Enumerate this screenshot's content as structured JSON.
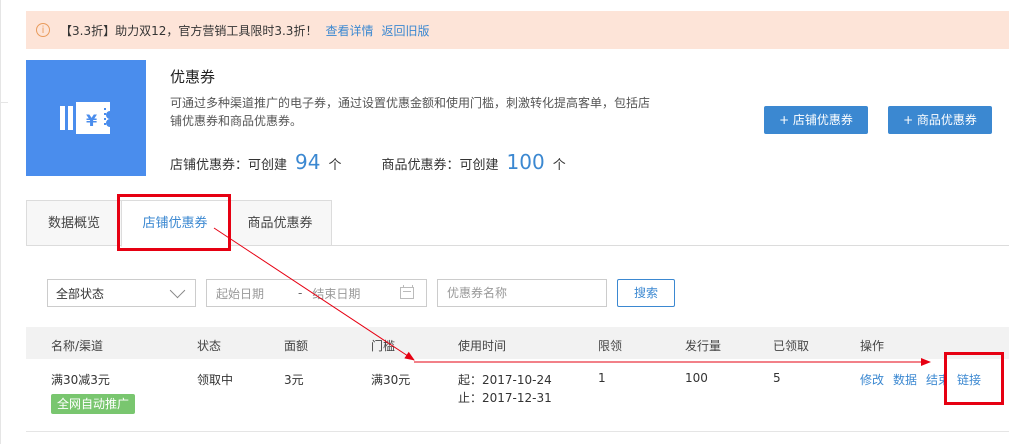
{
  "notice": {
    "text": "【3.3折】助力双12，官方营销工具限时3.3折！",
    "details_link": "查看详情",
    "old_version_link": "返回旧版"
  },
  "header": {
    "title": "优惠券",
    "description": "可通过多种渠道推广的电子券，通过设置优惠金额和使用门槛，刺激转化提高客单，包括店铺优惠券和商品优惠券。",
    "shop_quota_label": "店铺优惠券：可创建",
    "shop_quota_num": "94",
    "goods_quota_label": "商品优惠券：可创建",
    "goods_quota_num": "100",
    "unit": "个",
    "btn_shop": "+ 店铺优惠券",
    "btn_goods": "+ 商品优惠券"
  },
  "tabs": [
    "数据概览",
    "店铺优惠券",
    "商品优惠券"
  ],
  "filters": {
    "status": "全部状态",
    "start_placeholder": "起始日期",
    "dash": "-",
    "end_placeholder": "结束日期",
    "name_placeholder": "优惠券名称",
    "search": "搜索"
  },
  "table": {
    "headers": [
      "名称/渠道",
      "状态",
      "面额",
      "门槛",
      "使用时间",
      "限领",
      "发行量",
      "已领取",
      "操作"
    ],
    "row": {
      "name": "满30减3元",
      "tag": "全网自动推广",
      "status": "领取中",
      "value": "3元",
      "threshold": "满30元",
      "start": "起：2017-10-24",
      "end": "止：2017-12-31",
      "limit": "1",
      "issued": "100",
      "received": "5",
      "ops": [
        "修改",
        "数据",
        "结束",
        "链接"
      ]
    }
  },
  "colors": {
    "accent": "#3b88d1",
    "annotation": "#e60012",
    "tag": "#79c66f"
  }
}
